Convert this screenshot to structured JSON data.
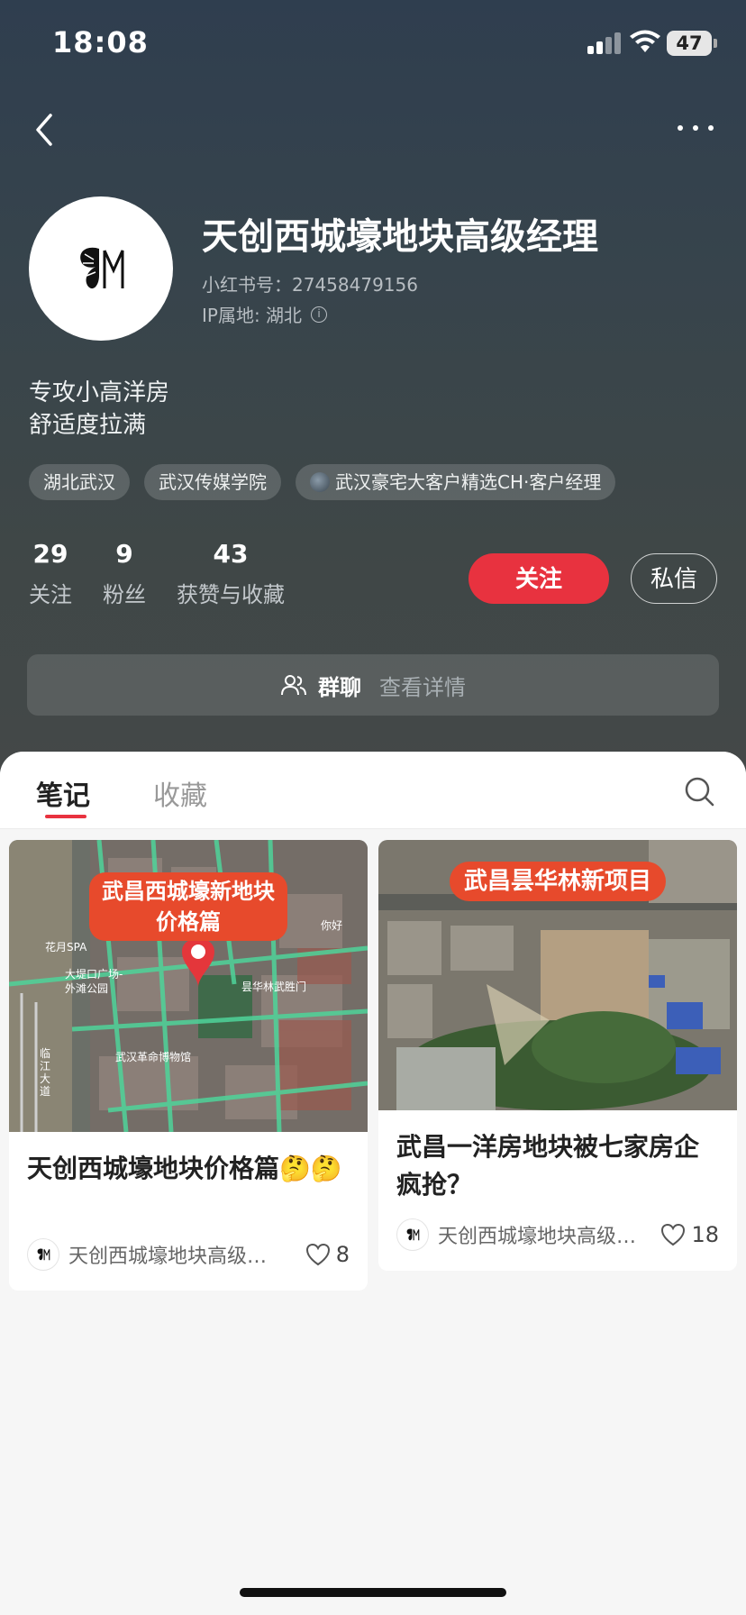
{
  "status_bar": {
    "time": "18:08",
    "battery": "47"
  },
  "profile": {
    "name": "天创西城壕地块高级经理",
    "red_id": "小红书号：27458479156",
    "ip_location": "IP属地: 湖北",
    "bio_line1": "专攻小高洋房",
    "bio_line2": "舒适度拉满",
    "tags": [
      "湖北武汉",
      "武汉传媒学院",
      "武汉豪宅大客户精选CH·客户经理"
    ]
  },
  "stats": [
    {
      "num": "29",
      "label": "关注"
    },
    {
      "num": "9",
      "label": "粉丝"
    },
    {
      "num": "43",
      "label": "获赞与收藏"
    }
  ],
  "actions": {
    "follow": "关注",
    "message": "私信"
  },
  "group": {
    "title": "群聊",
    "detail": "查看详情"
  },
  "tabs": {
    "notes": "笔记",
    "favorites": "收藏"
  },
  "notes": [
    {
      "banner_line1": "武昌西城壕新地块",
      "banner_line2": "价格篇",
      "map_labels": [
        "花月SPA",
        "大堤口广场-",
        "外滩公园",
        "武汉革命博物馆",
        "昙华林武胜门",
        "你好",
        "临江大道"
      ],
      "title": "天创西城壕地块价格篇🤔🤔",
      "author": "天创西城壕地块高级…",
      "likes": "8"
    },
    {
      "banner_line1": "武昌昙华林新项目",
      "title": "武昌一洋房地块被七家房企疯抢？",
      "author": "天创西城壕地块高级…",
      "likes": "18"
    }
  ],
  "colors": {
    "accent": "#e8323f",
    "header_bg": "#37444c",
    "banner": "#e74a2c"
  },
  "icons": [
    "back-icon",
    "more-icon",
    "info-icon",
    "group-icon",
    "search-icon",
    "heart-icon",
    "butterfly-logo-icon"
  ]
}
